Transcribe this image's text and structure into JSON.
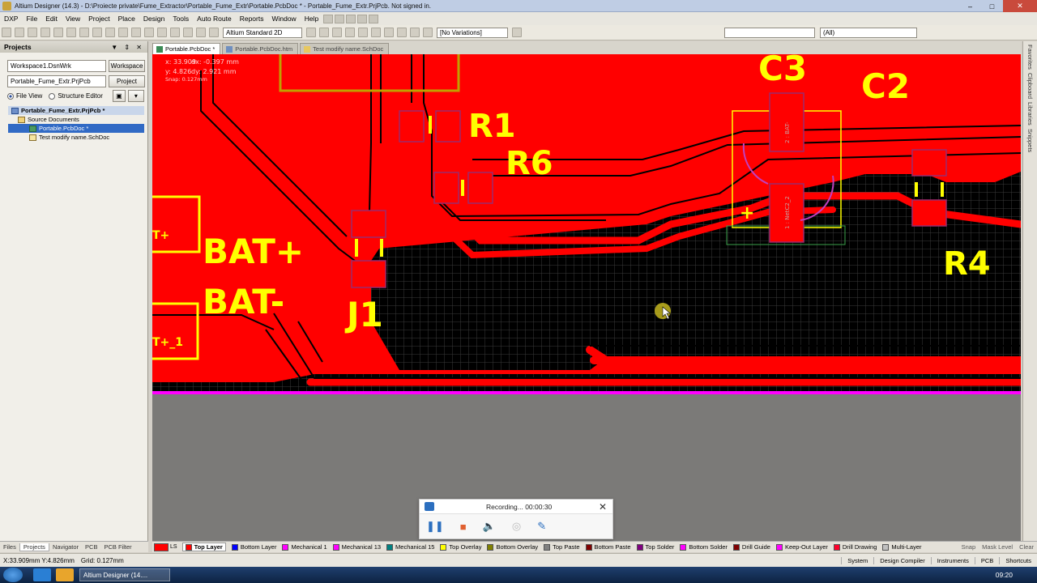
{
  "window": {
    "title": "Altium Designer (14.3) - D:\\Proiecte private\\Fume_Extractor\\Portable_Fume_Extr\\Portable.PcbDoc * - Portable_Fume_Extr.PrjPcb. Not signed in."
  },
  "menu": {
    "items": [
      "DXP",
      "File",
      "Edit",
      "View",
      "Project",
      "Place",
      "Design",
      "Tools",
      "Auto Route",
      "Reports",
      "Window",
      "Help"
    ]
  },
  "toolbar": {
    "view_mode": "Altium Standard 2D",
    "variations": "[No Variations]",
    "filter": "(All)"
  },
  "projects_panel": {
    "title": "Projects",
    "workspace": "Workspace1.DsnWrk",
    "workspace_button": "Workspace",
    "project": "Portable_Fume_Extr.PrjPcb",
    "project_button": "Project",
    "file_view": "File View",
    "structure_editor": "Structure Editor",
    "tree": {
      "project": "Portable_Fume_Extr.PrjPcb *",
      "folder": "Source Documents",
      "files": [
        "Portable.PcbDoc *",
        "Test modify name.SchDoc"
      ]
    }
  },
  "panel_tabs": [
    "Files",
    "Projects",
    "Navigator",
    "PCB",
    "PCB Filter"
  ],
  "doc_tabs": [
    "Portable.PcbDoc *",
    "Portable.PcbDoc.htm",
    "Test modify name.SchDoc"
  ],
  "right_strip": [
    "Favorites",
    "Clipboard",
    "Libraries",
    "Snippets"
  ],
  "hud": {
    "x": "x:   33.909",
    "dx": "dx: -0.397 mm",
    "y": "y:   4.826",
    "dy": "dy: 2.921 mm",
    "snap": "Snap: 0.127mm"
  },
  "pcb": {
    "designators": [
      "C3",
      "C2",
      "R1",
      "R6",
      "R4",
      "J1",
      "BAT+",
      "BAT-",
      "T+",
      "T+_1"
    ],
    "pad_labels": [
      "2 : BAT-",
      "1 : NetC2_2"
    ],
    "colors": {
      "top_layer": "#ff0000",
      "overlay": "#ffff00",
      "keepout": "#ff00ff",
      "board": "#000000",
      "bg": "#7b7a78"
    }
  },
  "layers": [
    {
      "name": "Top Layer",
      "color": "#ff0000"
    },
    {
      "name": "Bottom Layer",
      "color": "#0000ff"
    },
    {
      "name": "Mechanical 1",
      "color": "#ff00ff"
    },
    {
      "name": "Mechanical 13",
      "color": "#ff00ff"
    },
    {
      "name": "Mechanical 15",
      "color": "#008080"
    },
    {
      "name": "Top Overlay",
      "color": "#ffff00"
    },
    {
      "name": "Bottom Overlay",
      "color": "#808000"
    },
    {
      "name": "Top Paste",
      "color": "#808080"
    },
    {
      "name": "Bottom Paste",
      "color": "#800000"
    },
    {
      "name": "Top Solder",
      "color": "#800080"
    },
    {
      "name": "Bottom Solder",
      "color": "#ff00ff"
    },
    {
      "name": "Drill Guide",
      "color": "#800000"
    },
    {
      "name": "Keep-Out Layer",
      "color": "#ff00ff"
    },
    {
      "name": "Drill Drawing",
      "color": "#ff002a"
    },
    {
      "name": "Multi-Layer",
      "color": "#c0c0c0"
    }
  ],
  "layer_tab_links": [
    "Snap",
    "Mask Level",
    "Clear"
  ],
  "status": {
    "coords": "X:33.909mm Y:4.826mm",
    "grid": "Grid: 0.127mm",
    "right": [
      "System",
      "Design Compiler",
      "Instruments",
      "PCB",
      "Shortcuts"
    ]
  },
  "recorder": {
    "status": "Recording... 00:00:30"
  },
  "taskbar": {
    "task": "Altium Designer (14....",
    "clock": "09:20"
  }
}
